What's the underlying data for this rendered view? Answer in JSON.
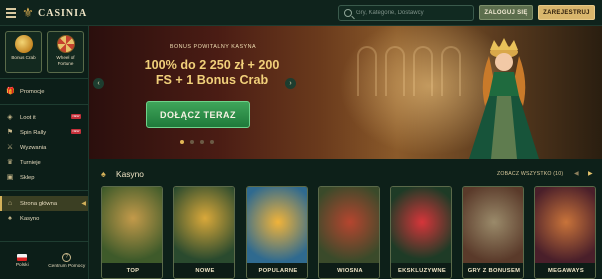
{
  "header": {
    "logo_text": "CASINIA",
    "search_placeholder": "Gry, Kategorie, Dostawcy",
    "login_label": "ZALOGUJ SIĘ",
    "register_label": "ZAREJESTRUJ"
  },
  "sidebar": {
    "promo_cards": [
      {
        "label": "Bonus Crab",
        "icon": "bonus-crab-icon"
      },
      {
        "label": "Wheel of Fortune",
        "icon": "wheel-of-fortune-icon"
      }
    ],
    "items": [
      {
        "label": "Promocje",
        "icon": "gift-icon"
      },
      {
        "label": "Loot it",
        "icon": "loot-icon",
        "badge": "NEW"
      },
      {
        "label": "Spin Rally",
        "icon": "rally-icon",
        "badge": "NEW"
      },
      {
        "label": "Wyzwania",
        "icon": "challenge-icon"
      },
      {
        "label": "Turnieje",
        "icon": "tournament-icon"
      },
      {
        "label": "Sklep",
        "icon": "shop-icon"
      },
      {
        "label": "Strona główna",
        "icon": "home-icon",
        "active": true
      },
      {
        "label": "Kasyno",
        "icon": "casino-icon"
      }
    ],
    "footer": {
      "language_label": "Polski",
      "help_label": "Centrum Pomocy"
    }
  },
  "hero": {
    "kicker": "BONUS POWITALNY KASYNA",
    "title_line1": "100% do 2 250 zł + 200",
    "title_line2": "FS + 1 Bonus Crab",
    "cta_label": "DOŁĄCZ TERAZ",
    "slides_total": 4,
    "active_slide": 1
  },
  "casino_section": {
    "title": "Kasyno",
    "see_all_label": "ZOBACZ WSZYSTKO (10)"
  },
  "games": [
    {
      "label": "TOP",
      "colors": [
        "#3e5a2a",
        "#c39a4a"
      ]
    },
    {
      "label": "NOWE",
      "colors": [
        "#2a4a2e",
        "#d9a83a"
      ]
    },
    {
      "label": "POPULARNE",
      "colors": [
        "#2f6a8f",
        "#f0b33a"
      ]
    },
    {
      "label": "WIOSNA",
      "colors": [
        "#3a4a2a",
        "#b5452f"
      ]
    },
    {
      "label": "EKSKLUZYWNE",
      "colors": [
        "#1e3b26",
        "#d6353a"
      ]
    },
    {
      "label": "GRY Z BONUSEM",
      "colors": [
        "#5a3a2a",
        "#9a8a6a"
      ]
    },
    {
      "label": "MEGAWAYS",
      "colors": [
        "#4a1f2a",
        "#c8733a"
      ]
    }
  ],
  "colors": {
    "accent_gold": "#d9b66c",
    "cta_green": "#1f7a3a",
    "background": "#0d2019"
  }
}
